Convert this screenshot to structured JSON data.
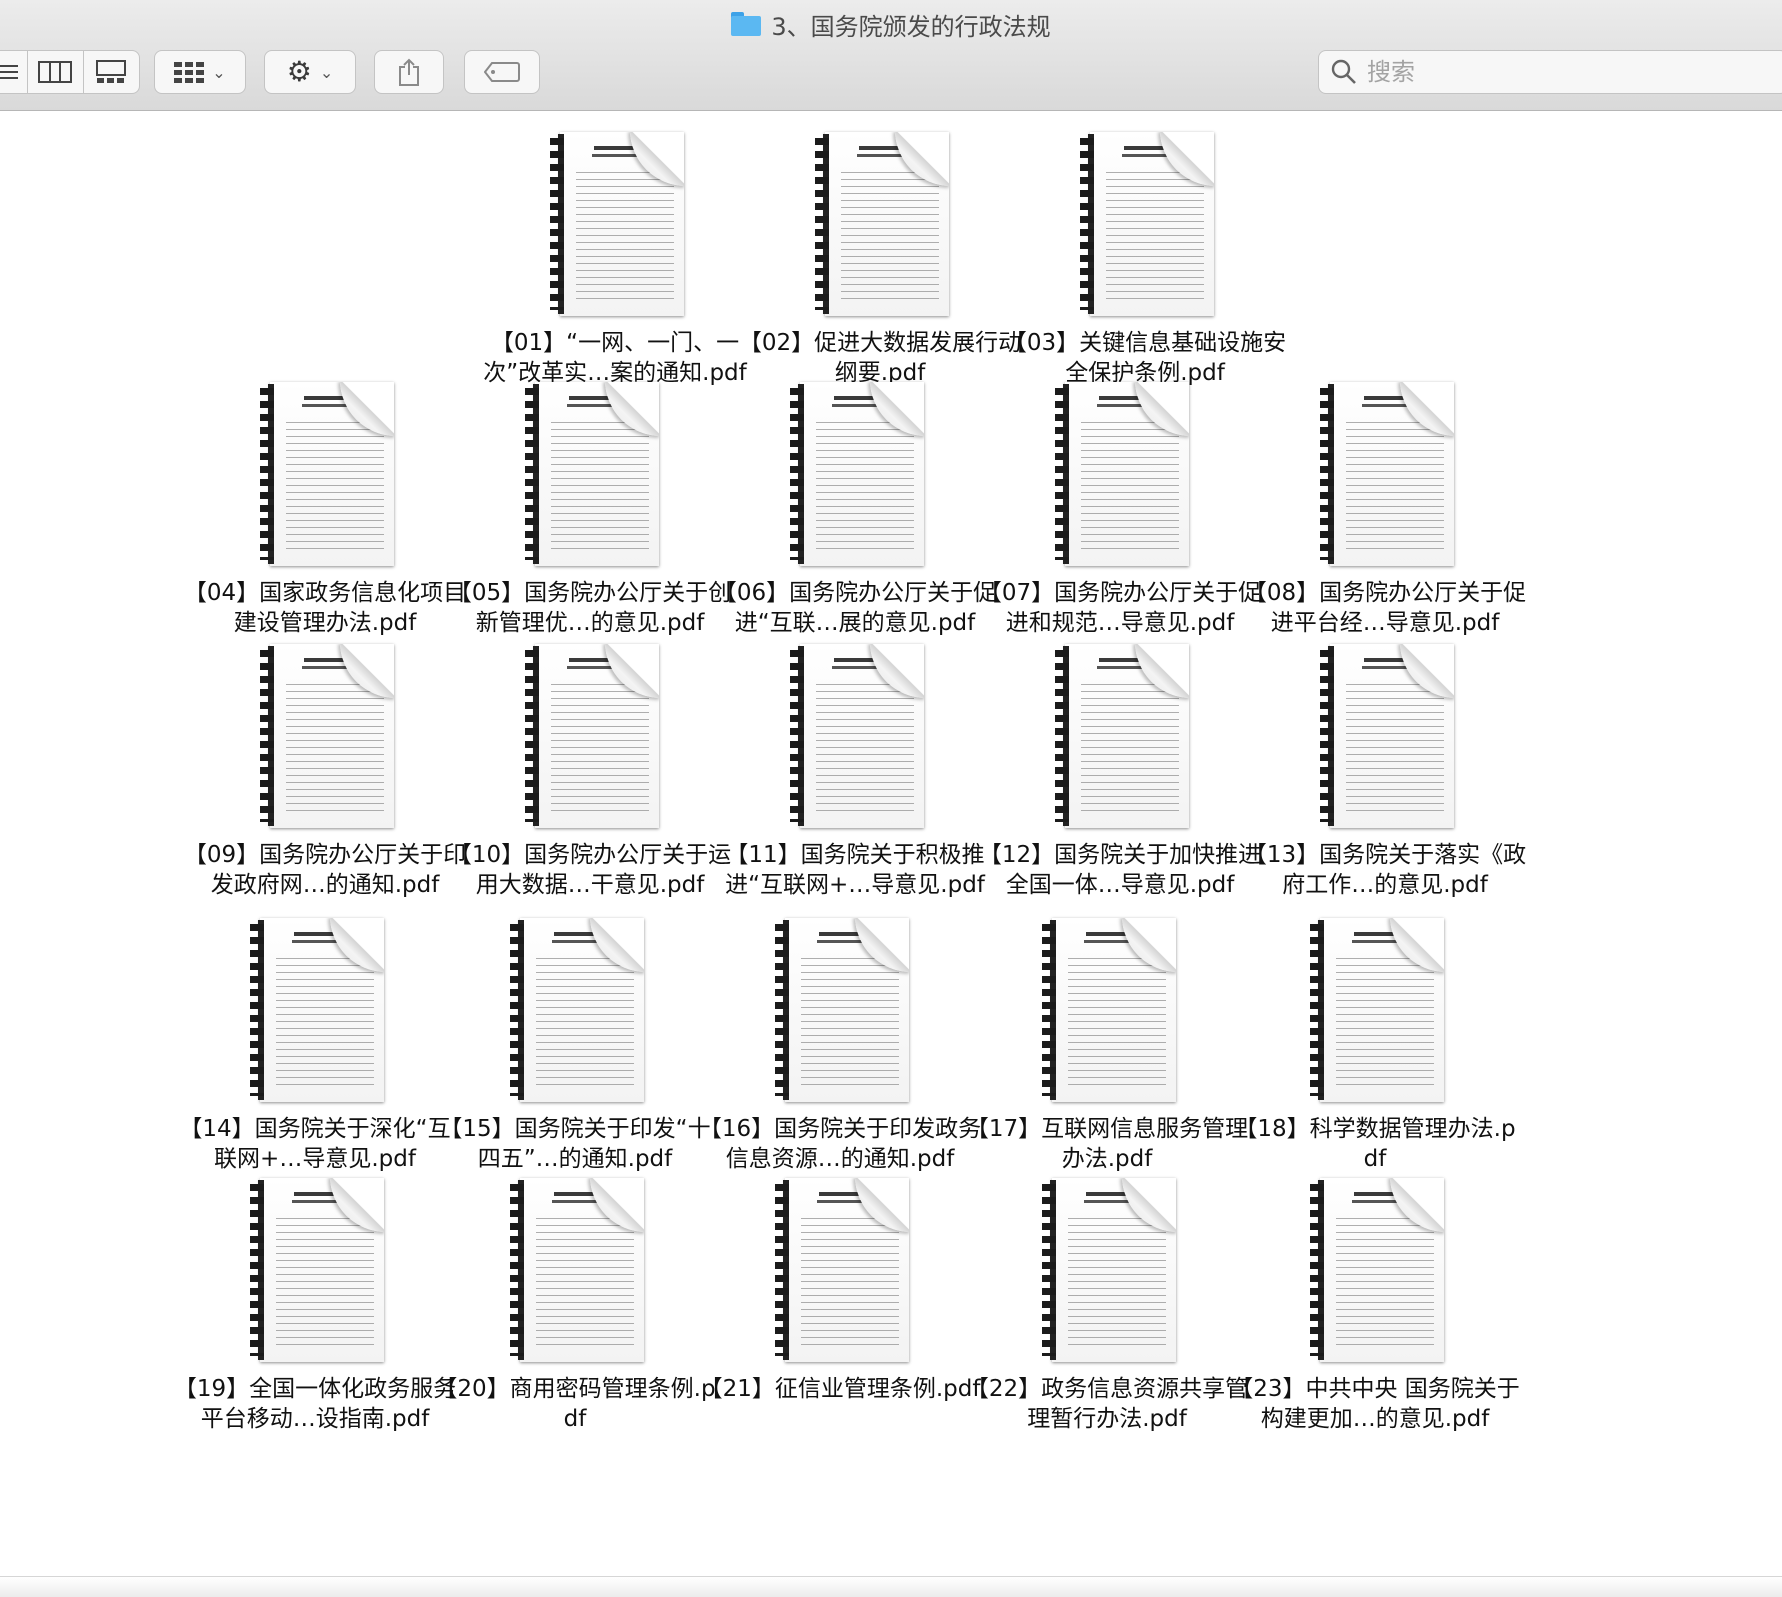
{
  "window": {
    "title": "3、国务院颁发的行政法规"
  },
  "toolbar": {
    "view_icons": [
      "list-view-icon",
      "column-view-icon",
      "gallery-view-icon"
    ],
    "group_icon": "grid-group-icon",
    "action_icon": "gear-icon",
    "share_icon": "share-icon",
    "tag_icon": "tag-icon"
  },
  "search": {
    "placeholder": "搜索",
    "value": ""
  },
  "files": [
    {
      "name": "【01】“一网、一门、一次”改革实…案的通知.pdf"
    },
    {
      "name": "【02】促进大数据发展行动纲要.pdf"
    },
    {
      "name": "【03】关键信息基础设施安全保护条例.pdf"
    },
    {
      "name": "【04】国家政务信息化项目建设管理办法.pdf"
    },
    {
      "name": "【05】国务院办公厅关于创新管理优…的意见.pdf"
    },
    {
      "name": "【06】国务院办公厅关于促进“互联…展的意见.pdf"
    },
    {
      "name": "【07】国务院办公厅关于促进和规范…导意见.pdf"
    },
    {
      "name": "【08】国务院办公厅关于促进平台经…导意见.pdf"
    },
    {
      "name": "【09】国务院办公厅关于印发政府网…的通知.pdf"
    },
    {
      "name": "【10】国务院办公厅关于运用大数据…干意见.pdf"
    },
    {
      "name": "【11】国务院关于积极推进“互联网+…导意见.pdf"
    },
    {
      "name": "【12】国务院关于加快推进全国一体…导意见.pdf"
    },
    {
      "name": "【13】国务院关于落实《政府工作…的意见.pdf"
    },
    {
      "name": "【14】国务院关于深化“互联网+…导意见.pdf"
    },
    {
      "name": "【15】国务院关于印发“十四五”…的通知.pdf"
    },
    {
      "name": "【16】国务院关于印发政务信息资源…的通知.pdf"
    },
    {
      "name": "【17】互联网信息服务管理办法.pdf"
    },
    {
      "name": "【18】科学数据管理办法.pdf"
    },
    {
      "name": "【19】全国一体化政务服务平台移动…设指南.pdf"
    },
    {
      "name": "【20】商用密码管理条例.pdf"
    },
    {
      "name": "【21】征信业管理条例.pdf"
    },
    {
      "name": "【22】政务信息资源共享管理暂行办法.pdf"
    },
    {
      "name": "【23】中共中央 国务院关于构建更加…的意见.pdf"
    }
  ]
}
